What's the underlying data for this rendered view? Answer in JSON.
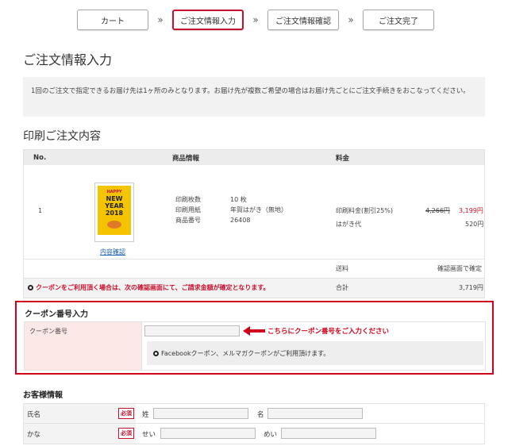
{
  "steps": [
    {
      "label": "カート",
      "active": false
    },
    {
      "label": "ご注文情報入力",
      "active": true
    },
    {
      "label": "ご注文情報確認",
      "active": false
    },
    {
      "label": "ご注文完了",
      "active": false
    }
  ],
  "step_separator": "»",
  "page_title": "ご注文情報入力",
  "notice": "1回のご注文で指定できるお届け先は1ヶ所のみとなります。お届け先が複数ご希望の場合はお届け先ごとにご注文手続きをおこなってください。",
  "order_section_title": "印刷ご注文内容",
  "order_table": {
    "headers": {
      "no": "No.",
      "product": "商品情報",
      "price": "料金"
    },
    "row": {
      "no": "1",
      "card_text": [
        "HAPPY",
        "NEW",
        "YEAR",
        "2018"
      ],
      "preview_link": "内容確認",
      "details": [
        {
          "label": "印刷枚数",
          "value": "10 枚"
        },
        {
          "label": "印刷用紙",
          "value": "年賀はがき（無地）"
        },
        {
          "label": "商品番号",
          "value": "26408"
        }
      ],
      "charges": [
        {
          "label": "印刷料金(割引25%)",
          "original": "4,266円",
          "value": "3,199円"
        },
        {
          "label": "はがき代",
          "original": "",
          "value": "520円"
        }
      ]
    },
    "shipping": {
      "label": "送料",
      "value": "確認画面で確定"
    },
    "coupon_notice": "クーポンをご利用頂く場合は、次の確認画面にて、ご請求金額が確定となります。",
    "total": {
      "label": "合計",
      "value": "3,719円"
    }
  },
  "coupon": {
    "title": "クーポン番号入力",
    "label": "クーポン番号",
    "input_value": "",
    "hint": "こちらにクーポン番号をご入力ください",
    "note": "Facebookクーポン、メルマガクーポンがご利用頂けます。"
  },
  "customer": {
    "title": "お客様情報",
    "required_badge": "必須",
    "rows": [
      {
        "label": "氏名",
        "first_label": "姓",
        "second_label": "名"
      },
      {
        "label": "かな",
        "first_label": "せい",
        "second_label": "めい"
      }
    ]
  },
  "colors": {
    "accent": "#c8102e",
    "link": "#1a5fb4",
    "card": "#f5c400"
  }
}
